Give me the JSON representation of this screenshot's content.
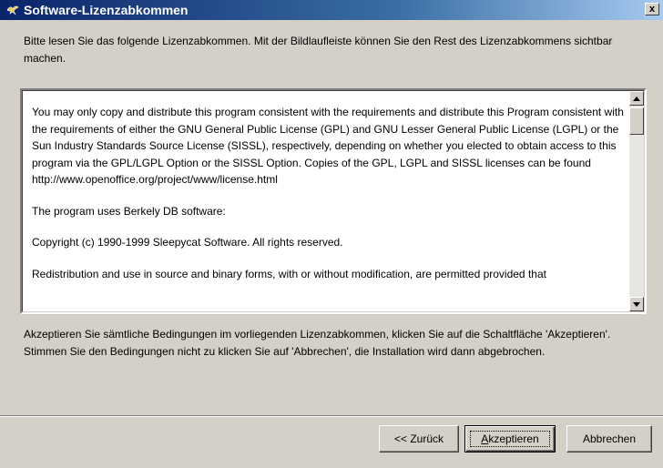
{
  "window": {
    "title": "Software-Lizenzabkommen",
    "title_icon": "bird-logo-icon",
    "close_label": "x",
    "colors": {
      "titlebar_start": "#0a246a",
      "titlebar_end": "#a6caf0",
      "face": "#d4d0c8"
    }
  },
  "intro": {
    "text": "Bitte lesen Sie das folgende Lizenzabkommen. Mit der Bildlaufleiste können Sie den Rest des Lizenzabkommens sichtbar machen."
  },
  "license": {
    "paragraphs": [
      "You may only copy and distribute this program consistent with the requirements and distribute this Program consistent with the requirements of either the GNU General Public License (GPL) and GNU Lesser General Public License (LGPL) or the Sun Industry Standards Source License (SISSL), respectively, depending on whether you elected to obtain access to this program via the GPL/LGPL Option or the SISSL Option. Copies of the GPL, LGPL and SISSL licenses can be found http://www.openoffice.org/project/www/license.html",
      "The program uses Berkely DB software:",
      "Copyright (c) 1990-1999 Sleepycat Software.  All rights reserved.",
      "Redistribution and use in source and binary forms, with or without modification, are permitted provided that"
    ]
  },
  "outro": {
    "text": "Akzeptieren Sie sämtliche Bedingungen im vorliegenden Lizenzabkommen, klicken Sie auf die Schaltfläche 'Akzeptieren'. Stimmen Sie den Bedingungen nicht zu klicken Sie auf 'Abbrechen', die Installation wird dann abgebrochen."
  },
  "buttons": {
    "back_label": "<< Zurück",
    "accept_label_prefix": "",
    "accept_label_underlined": "A",
    "accept_label_rest": "kzeptieren",
    "cancel_label": "Abbrechen"
  }
}
